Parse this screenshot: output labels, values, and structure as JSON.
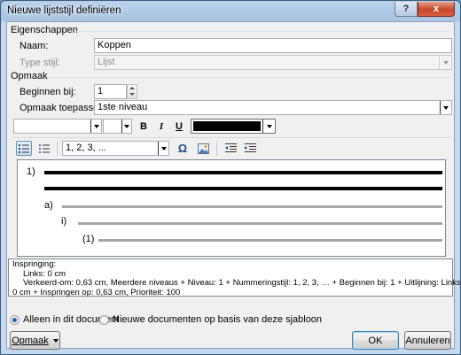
{
  "window": {
    "title": "Nieuwe lijststijl definiëren"
  },
  "titlebar": {
    "help_glyph": "?",
    "close_glyph": "x"
  },
  "eigenschappen": {
    "section_title": "Eigenschappen",
    "naam_label": "Naam:",
    "naam_value": "Koppen",
    "type_stijl_label": "Type stijl:",
    "type_stijl_value": "Lijst"
  },
  "opmaak": {
    "section_title": "Opmaak",
    "beginnen_bij_label": "Beginnen bij:",
    "beginnen_bij_value": "1",
    "toepassen_op_label": "Opmaak toepassen op:",
    "toepassen_op_value": "1ste niveau",
    "font_name_value": "",
    "font_size_value": "",
    "bold_glyph": "B",
    "italic_glyph": "I",
    "underline_glyph": "U",
    "font_color": "#000000",
    "numbering_style_value": "1, 2, 3, ...",
    "symbol_glyph": "Ω"
  },
  "preview": {
    "level1": "1)",
    "level2": "a)",
    "level3": "i)",
    "level4": "(1)"
  },
  "description": {
    "line1": "Inspringing:",
    "line2": "Links:  0 cm",
    "line3": "Verkeerd-om:  0,63 cm, Meerdere niveaus + Niveau: 1 + Nummeringstijl: 1, 2, 3, … + Beginnen bij: 1 + Uitlijning: Links + Uitgelijnd op:",
    "line4": "0 cm + Inspringen op:  0,63 cm, Prioriteit: 100"
  },
  "options": {
    "radio_document": "Alleen in dit document",
    "radio_template": "Nieuwe documenten op basis van deze sjabloon",
    "selected": "radio_document"
  },
  "buttons": {
    "opmaak": "Opmaak",
    "ok": "OK",
    "annuleren": "Annuleren"
  }
}
